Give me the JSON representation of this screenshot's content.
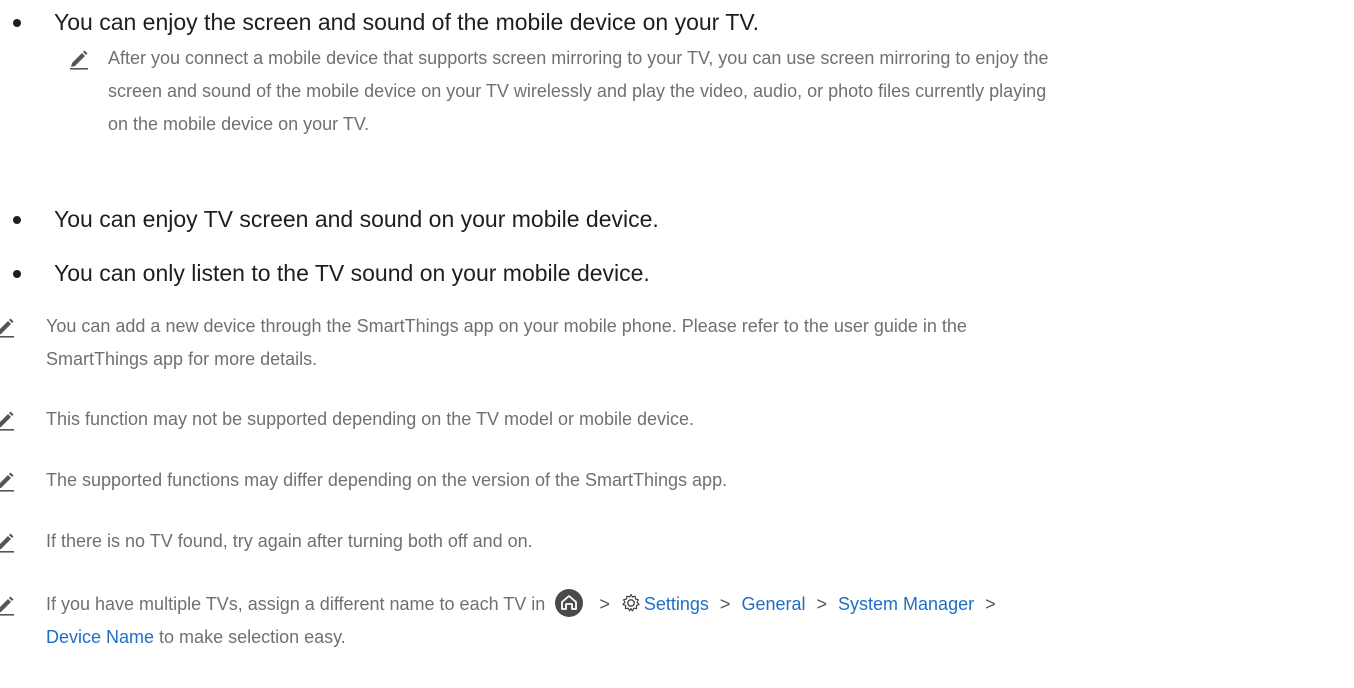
{
  "bullets": [
    {
      "text": "You can enjoy the screen and sound of the mobile device on your TV."
    },
    {
      "text": "You can enjoy TV screen and sound on your mobile device."
    },
    {
      "text": "You can only listen to the TV sound on your mobile device."
    }
  ],
  "sub_note": {
    "lines": [
      "After you connect a mobile device that supports screen mirroring to your TV, you can use screen mirroring to enjoy the",
      "screen and sound of the mobile device on your TV wirelessly and play the video, audio, or photo files currently playing",
      "on the mobile device on your TV."
    ]
  },
  "notes": [
    {
      "lines": [
        "You can add a new device through the SmartThings app on your mobile phone. Please refer to the user guide in the",
        "SmartThings app for more details."
      ]
    },
    {
      "lines": [
        "This function may not be supported depending on the TV model or mobile device."
      ]
    },
    {
      "lines": [
        "The supported functions may differ depending on the version of the SmartThings app."
      ]
    },
    {
      "lines": [
        "If there is no TV found, try again after turning both off and on."
      ]
    }
  ],
  "last_note": {
    "prefix": "If you have multiple TVs, assign a different name to each TV in",
    "chevron": ">",
    "path": [
      "Settings",
      "General",
      "System Manager"
    ],
    "line2_link": "Device Name",
    "line2_suffix": " to make selection easy."
  },
  "icons": {
    "note": "pencil-icon",
    "home": "home-icon",
    "settings": "gear-icon"
  },
  "colors": {
    "text": "#1e1e1e",
    "note_text": "#707070",
    "link": "#1e6fc4",
    "icon": "#555555"
  }
}
